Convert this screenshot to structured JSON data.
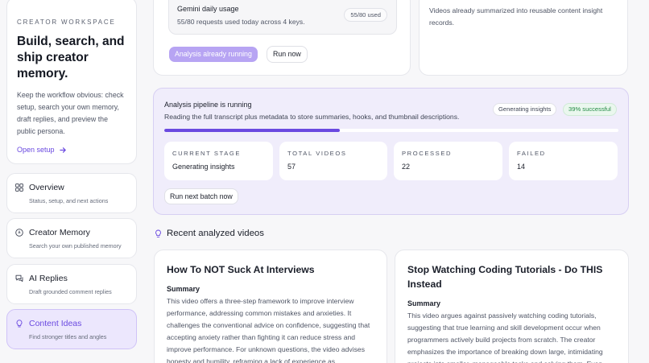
{
  "sidebar": {
    "kicker": "CREATOR WORKSPACE",
    "title": "Build, search, and ship creator memory.",
    "description": "Keep the workflow obvious: check setup, search your own memory, draft replies, and preview the public persona.",
    "open_setup": "Open setup",
    "nav": [
      {
        "title": "Overview",
        "subtitle": "Status, setup, and next actions",
        "icon": "grid-icon"
      },
      {
        "title": "Creator Memory",
        "subtitle": "Search your own published memory",
        "icon": "memory-icon"
      },
      {
        "title": "AI Replies",
        "subtitle": "Draft grounded comment replies",
        "icon": "chat-icon"
      },
      {
        "title": "Content Ideas",
        "subtitle": "Find stronger titles and angles",
        "icon": "lightbulb-icon",
        "active": true
      }
    ]
  },
  "usage": {
    "title": "Gemini daily usage",
    "description": "55/80 requests used today across 4 keys.",
    "pill": "55/80 used",
    "btn_running": "Analysis already running",
    "btn_run_now": "Run now"
  },
  "insights_note": {
    "text": "Videos already summarized into reusable content insight records."
  },
  "pipeline": {
    "title": "Analysis pipeline is running",
    "description": "Reading the full transcript plus metadata to store summaries, hooks, and thumbnail descriptions.",
    "status_pill": "Generating insights",
    "success_pill": "39% successful",
    "progress": 0.386,
    "stats": [
      {
        "label": "CURRENT STAGE",
        "value": "Generating insights"
      },
      {
        "label": "TOTAL VIDEOS",
        "value": "57"
      },
      {
        "label": "PROCESSED",
        "value": "22"
      },
      {
        "label": "FAILED",
        "value": "14"
      }
    ],
    "btn_next_batch": "Run next batch now"
  },
  "recent": {
    "title": "Recent analyzed videos",
    "videos": [
      {
        "title": "How To NOT Suck At Interviews",
        "summary_label": "Summary",
        "summary": "This video offers a three-step framework to improve interview performance, addressing common mistakes and anxieties. It challenges the conventional advice on confidence, suggesting that accepting anxiety rather than fighting it can reduce stress and improve performance. For unknown questions, the video advises honesty and humility, reframing a lack of experience as"
      },
      {
        "title": "Stop Watching Coding Tutorials - Do THIS Instead",
        "summary_label": "Summary",
        "summary": "This video argues against passively watching coding tutorials, suggesting that true learning and skill development occur when programmers actively build projects from scratch. The creator emphasizes the importance of breaking down large, intimidating projects into smaller, manageable tasks and solving them. Even"
      }
    ]
  },
  "colors": {
    "accent": "#6a49e0",
    "success": "#228a44",
    "pipeline_bg": "#f0edfb"
  }
}
